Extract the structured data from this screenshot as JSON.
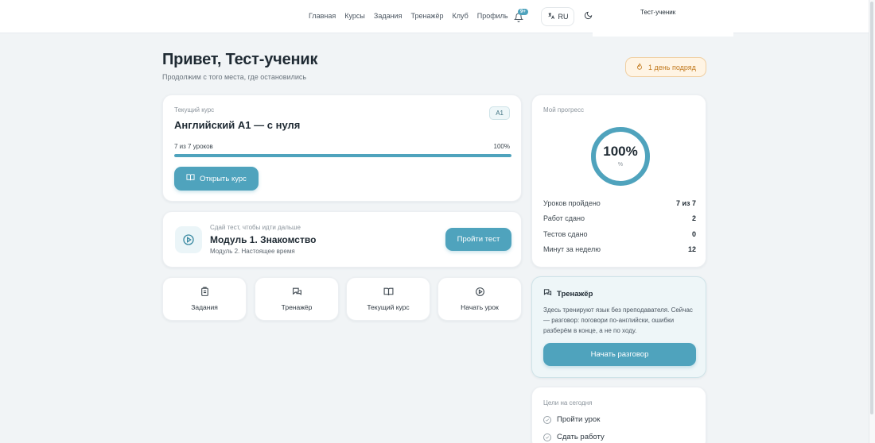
{
  "nav": {
    "items": [
      "Главная",
      "Курсы",
      "Задания",
      "Тренажёр",
      "Клуб",
      "Профиль"
    ],
    "notifications_badge": "9+",
    "language": "RU",
    "user_name": "Тест-ученик"
  },
  "greeting": {
    "title": "Привет, Тест-ученик",
    "subtitle": "Продолжим с того места, где остановились",
    "streak": "1 день подряд"
  },
  "current_course": {
    "label": "Текущий курс",
    "title": "Английский A1 — с нуля",
    "level": "A1",
    "progress_text": "7 из 7 уроков",
    "progress_percent_text": "100%",
    "progress_fraction": 1.0,
    "button": "Открыть курс"
  },
  "test": {
    "hint": "Сдай тест, чтобы идти дальше",
    "title": "Модуль 1. Знакомство",
    "next": "Модуль 2. Настоящее время",
    "button": "Пройти тест"
  },
  "tiles": [
    {
      "label": "Задания",
      "icon": "clipboard-icon"
    },
    {
      "label": "Тренажёр",
      "icon": "chat-icon"
    },
    {
      "label": "Текущий курс",
      "icon": "book-icon"
    },
    {
      "label": "Начать урок",
      "icon": "play-circle-icon"
    }
  ],
  "my_progress": {
    "label": "Мой прогресс",
    "percent_text": "100%",
    "unit": "%",
    "fraction": 1.0,
    "stats": [
      {
        "label": "Уроков пройдено",
        "value": "7 из 7"
      },
      {
        "label": "Работ сдано",
        "value": "2"
      },
      {
        "label": "Тестов сдано",
        "value": "0"
      },
      {
        "label": "Минут за неделю",
        "value": "12"
      }
    ]
  },
  "trainer": {
    "title": "Тренажёр",
    "text": "Здесь тренируют язык без преподавателя. Сейчас — разговор: поговори по-английски, ошибки разберём в конце, а не по ходу.",
    "button": "Начать разговор"
  },
  "goals": {
    "label": "Цели на сегодня",
    "items": [
      "Пройти урок",
      "Сдать работу"
    ]
  },
  "colors": {
    "accent": "#4fa3bd",
    "streak_text": "#c27a1f",
    "streak_bg": "#fff4e4"
  }
}
